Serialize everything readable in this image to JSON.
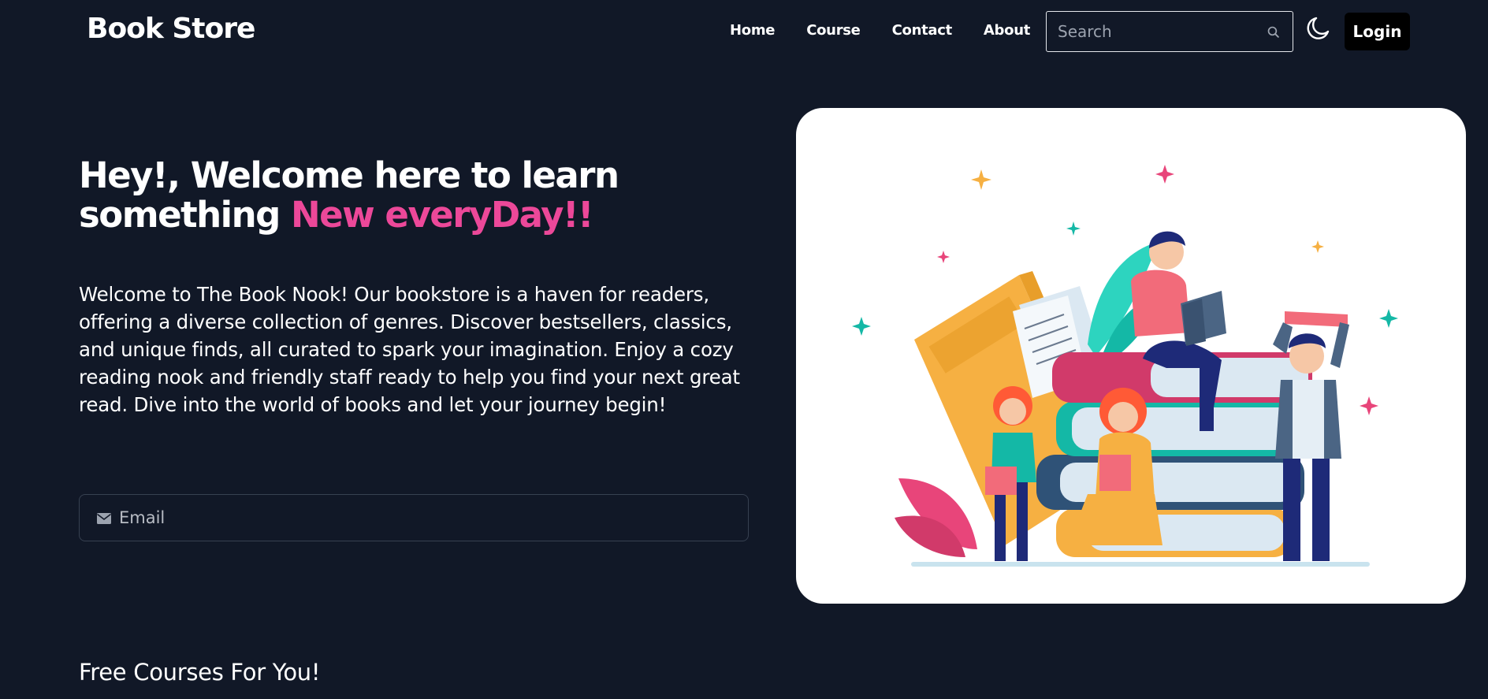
{
  "brand": {
    "title": "Book Store"
  },
  "nav": {
    "items": [
      {
        "label": "Home"
      },
      {
        "label": "Course"
      },
      {
        "label": "Contact"
      },
      {
        "label": "About"
      }
    ],
    "search": {
      "placeholder": "Search",
      "value": ""
    },
    "theme_toggle_icon": "moon-icon",
    "login_label": "Login"
  },
  "hero": {
    "title_part1": "Hey!, Welcome here to learn something ",
    "title_accent": "New everyDay!!",
    "paragraph": "Welcome to The Book Nook! Our bookstore is a haven for readers, offering a diverse collection of genres. Discover bestsellers, classics, and unique finds, all curated to spark your imagination. Enjoy a cozy reading nook and friendly staff ready to help you find your next great read. Dive into the world of books and let your journey begin!",
    "email": {
      "placeholder": "Email",
      "value": "",
      "icon": "mail-icon"
    }
  },
  "courses": {
    "section_title": "Free Courses For You!"
  },
  "colors": {
    "background": "#111827",
    "accent": "#ec4899",
    "login_bg": "#000000",
    "card_bg": "#ffffff"
  }
}
